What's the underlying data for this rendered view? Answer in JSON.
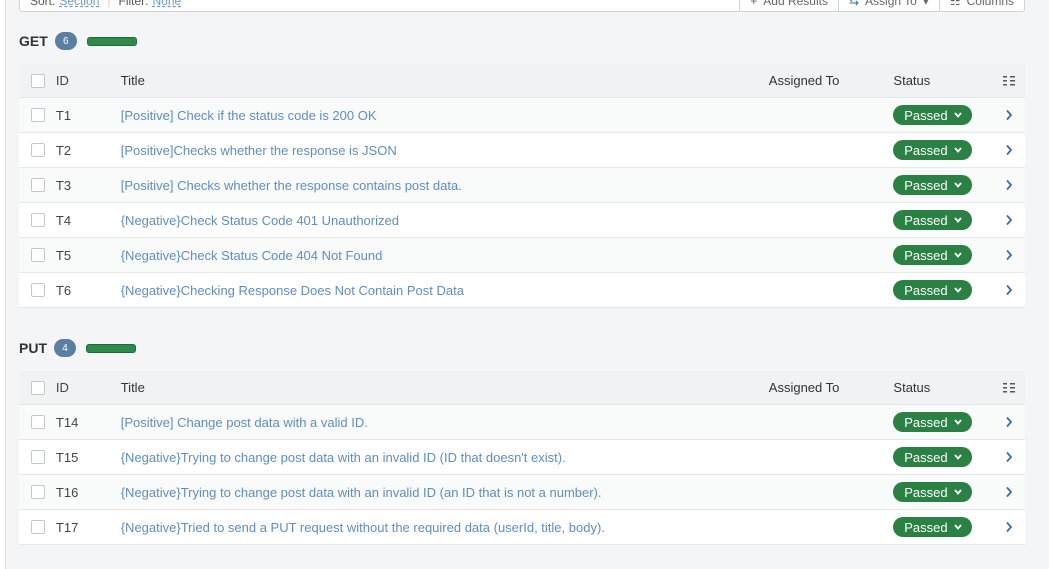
{
  "toolbar": {
    "sort_label": "Sort:",
    "sort_value": "Section",
    "filter_label": "Filter:",
    "filter_value": "None",
    "add_results": "Add Results",
    "assign_to": "Assign To",
    "columns": "Columns"
  },
  "table_headers": {
    "id": "ID",
    "title": "Title",
    "assigned_to": "Assigned To",
    "status": "Status"
  },
  "colors": {
    "passed": "#2a8143",
    "badge": "#5b7fa3",
    "link": "#5f8ec0"
  },
  "sections": [
    {
      "name": "GET",
      "count": "6",
      "progress_passed": 1.0,
      "rows": [
        {
          "id": "T1",
          "title": "[Positive] Check if the status code is 200 OK",
          "assigned": "",
          "status": "Passed"
        },
        {
          "id": "T2",
          "title": "[Positive]Checks whether the response is JSON",
          "assigned": "",
          "status": "Passed"
        },
        {
          "id": "T3",
          "title": "[Positive] Checks whether the response contains post data.",
          "assigned": "",
          "status": "Passed"
        },
        {
          "id": "T4",
          "title": "{Negative}Check Status Code 401 Unauthorized",
          "assigned": "",
          "status": "Passed"
        },
        {
          "id": "T5",
          "title": "{Negative}Check Status Code 404 Not Found",
          "assigned": "",
          "status": "Passed"
        },
        {
          "id": "T6",
          "title": "{Negative}Checking Response Does Not Contain Post Data",
          "assigned": "",
          "status": "Passed"
        }
      ]
    },
    {
      "name": "PUT",
      "count": "4",
      "progress_passed": 1.0,
      "rows": [
        {
          "id": "T14",
          "title": "[Positive] Change post data with a valid ID.",
          "assigned": "",
          "status": "Passed"
        },
        {
          "id": "T15",
          "title": "{Negative}Trying to change post data with an invalid ID (ID that doesn't exist).",
          "assigned": "",
          "status": "Passed"
        },
        {
          "id": "T16",
          "title": "{Negative}Trying to change post data with an invalid ID (an ID that is not a number).",
          "assigned": "",
          "status": "Passed"
        },
        {
          "id": "T17",
          "title": "{Negative}Tried to send a PUT request without the required data (userId, title, body).",
          "assigned": "",
          "status": "Passed"
        }
      ]
    }
  ]
}
